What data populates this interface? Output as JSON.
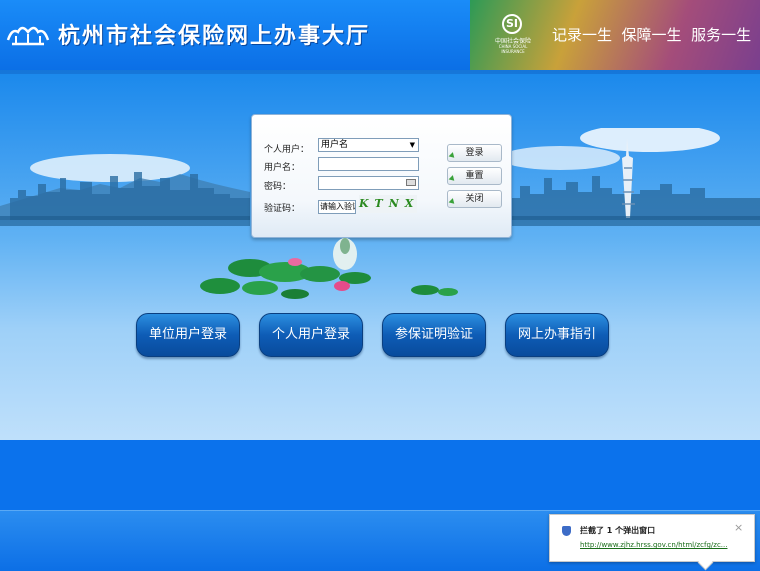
{
  "header": {
    "site_title": "杭州市社会保险网上办事大厅",
    "insurance_logo": {
      "mark": "SI",
      "name_cn": "中国社会保险",
      "name_en": "CHINA SOCIAL INSURANCE"
    },
    "slogan": "记录一生  保障一生  服务一生"
  },
  "login": {
    "user_type_label": "个人用户：",
    "user_type_selected": "用户名",
    "username_label": "用户名：",
    "username_value": "",
    "password_label": "密码：",
    "password_value": "",
    "captcha_label": "验证码：",
    "captcha_input_value": "请输入验证码",
    "captcha_text": "KTNX",
    "login_button": "登录",
    "reset_button": "重置",
    "close_button": "关闭"
  },
  "nav": {
    "buttons": [
      "单位用户登录",
      "个人用户登录",
      "参保证明验证",
      "网上办事指引"
    ]
  },
  "popup": {
    "title": "拦截了 1 个弹出窗口",
    "close": "×",
    "link": "http://www.zjhz.hrss.gov.cn/html/zcfg/zc..."
  },
  "colors": {
    "header_blue": "#0b6fe6",
    "nav_button": "#0e5cb6",
    "captcha_green": "#2a8a1f"
  }
}
